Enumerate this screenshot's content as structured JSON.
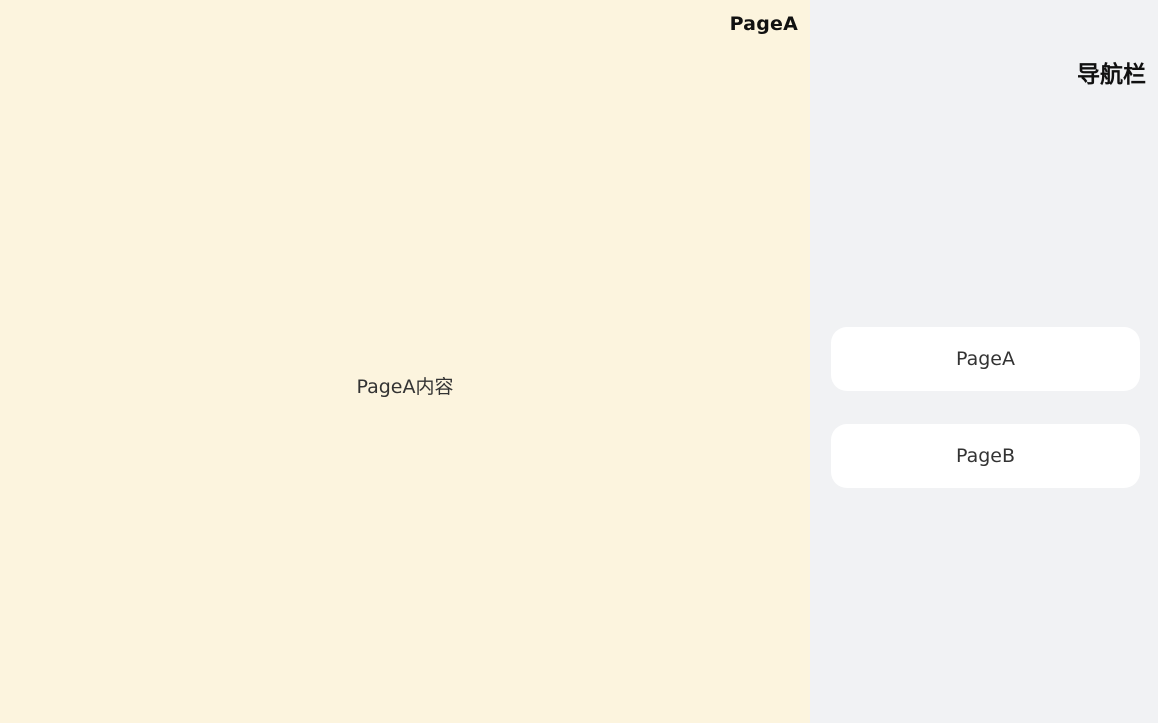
{
  "colors": {
    "content_background": "#FCF4DE",
    "nav_background": "#F1F2F4",
    "button_background": "#FFFFFF"
  },
  "content": {
    "title": "PageA",
    "body_text": "PageA内容"
  },
  "navigation": {
    "title": "导航栏",
    "items": [
      {
        "label": "PageA"
      },
      {
        "label": "PageB"
      }
    ]
  }
}
